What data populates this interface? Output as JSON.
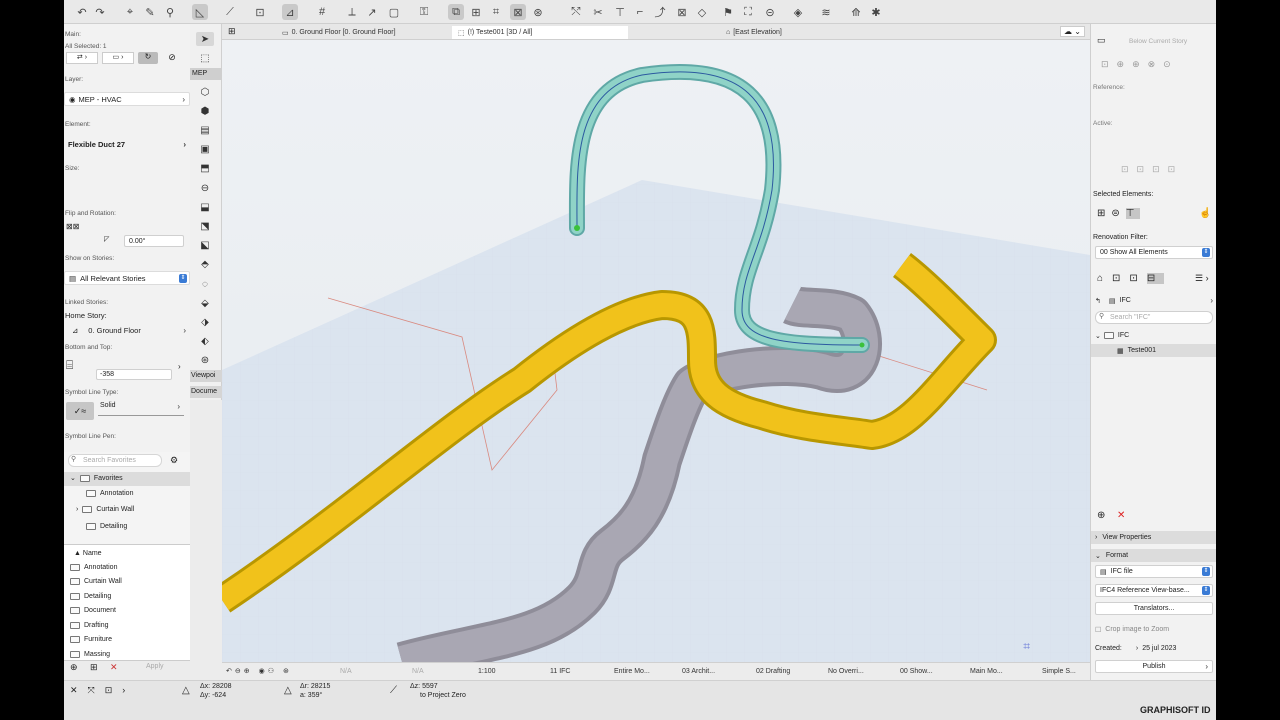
{
  "toolbar": {
    "icons": [
      "undo-icon",
      "redo-icon",
      "pick-up-icon",
      "eyedropper-icon",
      "inject-icon",
      "arrow-tool-icon",
      "line-tool-icon",
      "snap-icon",
      "guide-icon",
      "grid-icon",
      "measure-icon",
      "pointer-icon",
      "layer-icon",
      "lock-icon",
      "trace-icon",
      "compare-icon",
      "3d-icon",
      "paint-icon",
      "link-icon",
      "split-icon",
      "adjust-icon",
      "intersect-icon",
      "curve-icon",
      "frame-icon",
      "pin-icon",
      "flag-icon",
      "marker-icon",
      "window-icon",
      "sync-icon",
      "stack-icon",
      "gear-icon"
    ]
  },
  "left_panel": {
    "main_label": "Main:",
    "all_selected": "All Selected: 1",
    "layer_label": "Layer:",
    "layer_value": "MEP - HVAC",
    "element_label": "Element:",
    "element_value": "Flexible Duct 27",
    "size_label": "Size:",
    "flip_label": "Flip and Rotation:",
    "rotation_value": "0.00°",
    "show_on_stories_label": "Show on Stories:",
    "show_on_stories_value": "All Relevant Stories",
    "linked_stories_label": "Linked Stories:",
    "home_story_label": "Home Story:",
    "home_story_value": "0. Ground Floor",
    "bottom_top_label": "Bottom and Top:",
    "bottom_value": "-358",
    "symbol_line_type_label": "Symbol Line Type:",
    "symbol_line_type_value": "Solid",
    "symbol_line_pen_label": "Symbol Line Pen:",
    "search_placeholder": "Search Favorites",
    "favorites_label": "Favorites",
    "favorites_items": [
      "Annotation",
      "Curtain Wall",
      "Detailing"
    ],
    "name_header": "Name",
    "list_items": [
      "Annotation",
      "Curtain Wall",
      "Detailing",
      "Document",
      "Drafting",
      "Furniture",
      "Massing"
    ],
    "apply_label": "Apply"
  },
  "toolbox": {
    "mep_label": "MEP",
    "viewpoint_label": "Viewpoi",
    "document_label": "Docume"
  },
  "tabs": [
    {
      "label": "0. Ground Floor [0. Ground Floor]"
    },
    {
      "label": "(!) Teste001 [3D / All]"
    },
    {
      "label": "[East Elevation]"
    }
  ],
  "status_bar": {
    "na1": "N/A",
    "na2": "N/A",
    "scale": "1:100",
    "ifc": "11 IFC",
    "entire_model": "Entire Mo...",
    "arch": "03 Archit...",
    "drafting": "02 Drafting",
    "override": "No Overri...",
    "show": "00 Show...",
    "main_model": "Main Mo...",
    "simple": "Simple S..."
  },
  "coords": {
    "ax": "28208",
    "ay": "-624",
    "ar": "28215",
    "angle": "359°",
    "az": "5597",
    "ref": "to Project Zero"
  },
  "right_panel": {
    "below_story": "Below Current Story",
    "reference_label": "Reference:",
    "active_label": "Active:",
    "selected_elements_label": "Selected Elements:",
    "renovation_label": "Renovation Filter:",
    "renovation_value": "00 Show All Elements",
    "ifc_value": "IFC",
    "search_placeholder": "Search \"IFC\"",
    "tree_root": "IFC",
    "tree_child": "Teste001",
    "view_properties": "View Properties",
    "format_label": "Format",
    "format_value": "IFC file",
    "ifc_version": "IFC4 Reference View-base...",
    "translators": "Translators...",
    "crop_label": "Crop image to Zoom",
    "created_label": "Created:",
    "created_value": "25 jul 2023",
    "publish_label": "Publish"
  },
  "brand": "GRAPHISOFT ID"
}
